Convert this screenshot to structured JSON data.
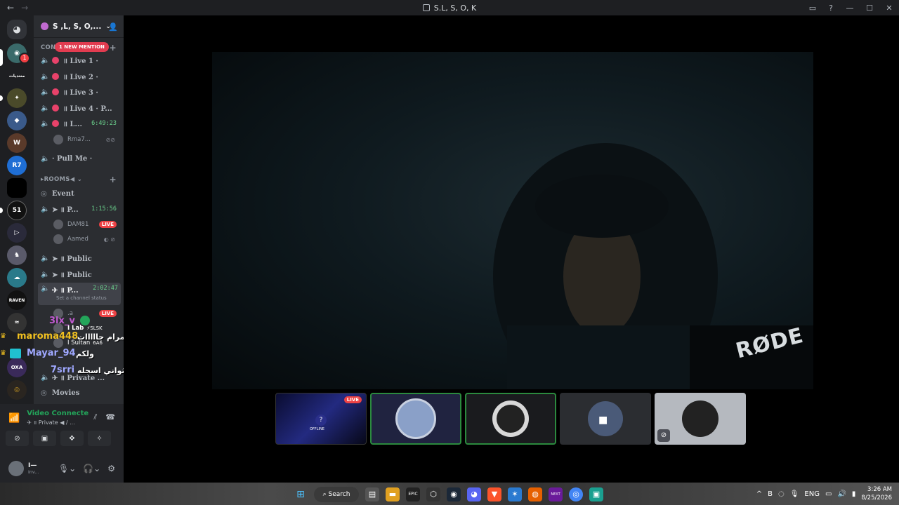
{
  "window": {
    "title": "S.L, S, O, K"
  },
  "server": {
    "name": "S ,L, S, O,..."
  },
  "mention_pill": "1 NEW MENTION",
  "categories": {
    "first": "CON",
    "rooms": "ROOMS"
  },
  "channels": [
    {
      "name": "॥ Live 1 ·"
    },
    {
      "name": "॥ Live 2 ·"
    },
    {
      "name": "॥ Live 3 ·"
    },
    {
      "name": "॥ Live 4 · P..."
    },
    {
      "name": "॥ L...",
      "timer": "6:49:23"
    },
    {
      "name": "· Pull Me ·"
    },
    {
      "name": "Event"
    },
    {
      "name": "➤ ॥ P...",
      "timer": "1:15:56"
    },
    {
      "name": "➤ ॥ Public"
    },
    {
      "name": "➤ ॥ Public"
    },
    {
      "name": "✈ ॥ P...",
      "timer": "2:02:47",
      "status": "Set a channel status"
    },
    {
      "name": "✈ ॥ Private ..."
    },
    {
      "name": "Movies"
    }
  ],
  "users": [
    {
      "name": "Rma7..."
    },
    {
      "name": "DAM81",
      "badge": "LIVE"
    },
    {
      "name": "Aamed"
    },
    {
      "name": ".a",
      "badge": "LIVE"
    },
    {
      "name": "I Lab",
      "extra": "⚡SLSK"
    },
    {
      "name": "I Sultan",
      "extra": "6A6"
    }
  ],
  "overlay": [
    {
      "user": "3lx_v",
      "msg": ""
    },
    {
      "user": "maroma448",
      "msg": "مرام جااااات"
    },
    {
      "user": "Mayar_94",
      "msg": "ولكم"
    },
    {
      "user": "7srri",
      "msg": "اجل ثواني اسجله"
    }
  ],
  "voice": {
    "title": "Video Connecte",
    "sub": "✈ ॥ Private ◀ / ..."
  },
  "user": {
    "name": "I—",
    "status": "Inv..."
  },
  "video": {
    "mic_brand": "RØDE"
  },
  "thumbs": {
    "live": "LIVE",
    "offline": "OFFLINE"
  },
  "taskbar": {
    "search": "Search",
    "lang": "ENG",
    "time": "3:26 AM",
    "date": "8/25/2026"
  }
}
